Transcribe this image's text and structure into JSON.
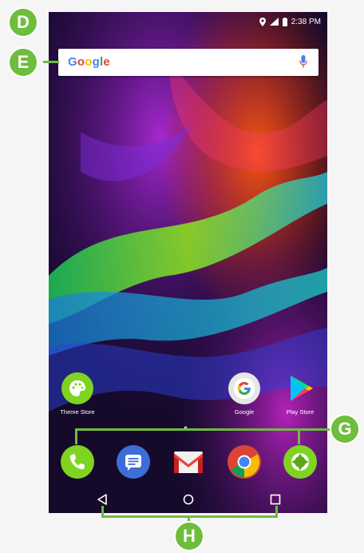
{
  "status_bar": {
    "time": "2:38 PM"
  },
  "search": {
    "logo": "Google"
  },
  "home_apps": [
    {
      "label": "Theme Store"
    },
    {
      "label": "Google"
    },
    {
      "label": "Play Store"
    }
  ],
  "dock": {
    "up_arrow": "^",
    "icons": [
      "phone-icon",
      "messages-icon",
      "gmail-icon",
      "chrome-icon",
      "camera-icon"
    ]
  },
  "nav": {
    "icons": [
      "back-icon",
      "home-icon",
      "recents-icon"
    ]
  },
  "callouts": {
    "d": "D",
    "e": "E",
    "g": "G",
    "h": "H"
  },
  "colors": {
    "callout_green": "#6ebd3d",
    "accent_green": "#7fd321"
  }
}
